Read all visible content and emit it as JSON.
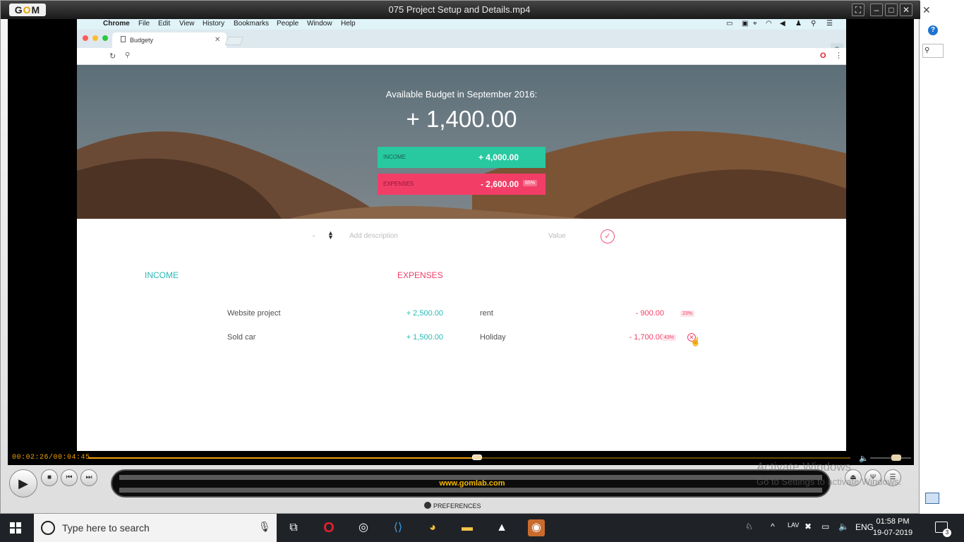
{
  "gom": {
    "title": "075 Project Setup and Details.mp4",
    "logo": "GOM",
    "timer": "00:02:26/00:04:45",
    "url": "www.gomlab.com",
    "preferences": "PREFERENCES",
    "progress_fraction": 0.51
  },
  "mac_menu": {
    "items": [
      "Chrome",
      "File",
      "Edit",
      "View",
      "History",
      "Bookmarks",
      "People",
      "Window",
      "Help"
    ]
  },
  "browser": {
    "tab_title": "Budgety"
  },
  "budget": {
    "title": "Available Budget in September 2016:",
    "value": "+ 1,400.00",
    "income_label": "Income",
    "income_value": "+ 4,000.00",
    "expenses_label": "Expenses",
    "expenses_value": "- 2,600.00",
    "expenses_percent": "65%"
  },
  "add": {
    "type_value": "-",
    "description_placeholder": "Add description",
    "value_placeholder": "Value"
  },
  "income": {
    "heading": "INCOME",
    "items": [
      {
        "description": "Website project",
        "value": "+ 2,500.00"
      },
      {
        "description": "Sold car",
        "value": "+ 1,500.00"
      }
    ]
  },
  "expenses": {
    "heading": "EXPENSES",
    "items": [
      {
        "description": "rent",
        "value": "- 900.00",
        "percent": "23%"
      },
      {
        "description": "Holiday",
        "value": "- 1,700.00",
        "percent": "43%"
      }
    ]
  },
  "watermark": {
    "line1": "Activate Windows",
    "line2": "Go to Settings to activate Windows."
  },
  "taskbar": {
    "search_placeholder": "Type here to search",
    "language": "ENG",
    "time": "01:58 PM",
    "date": "19-07-2019",
    "notification_count": "3"
  },
  "colors": {
    "income": "#28b9b5",
    "expense": "#f23e67",
    "gom_accent": "#f3a20c"
  }
}
